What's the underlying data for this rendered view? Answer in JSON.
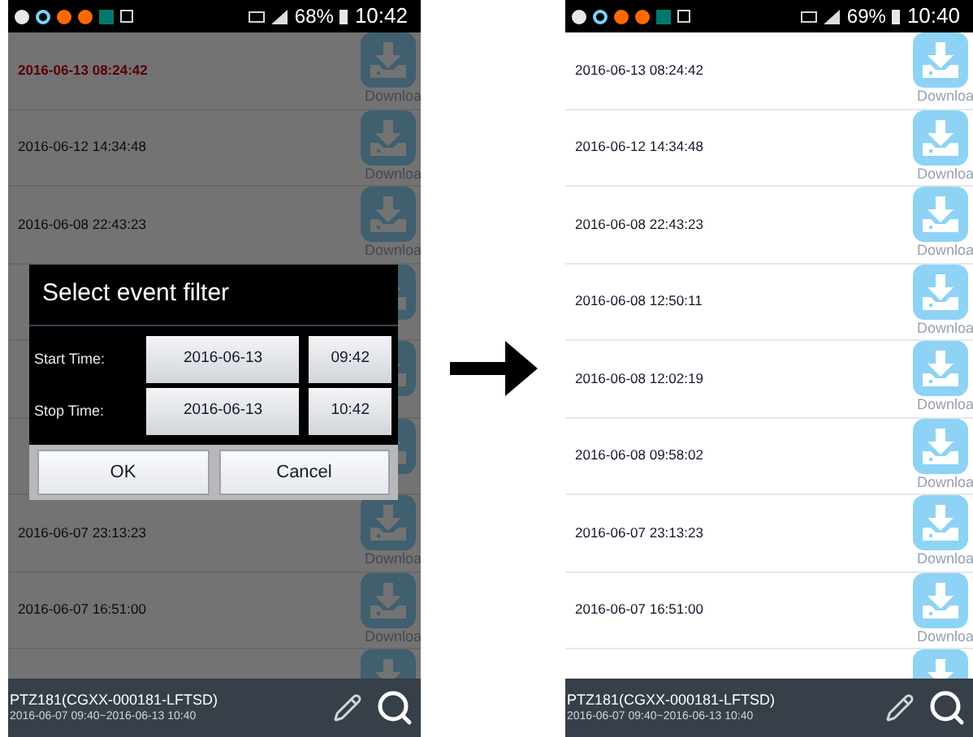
{
  "screens": [
    {
      "status_bar": {
        "battery": "68%",
        "time": "10:42"
      },
      "dimmed": true,
      "events": [
        {
          "time": "2016-06-13 08:24:42",
          "highlighted": true,
          "download": "Downloa"
        },
        {
          "time": "2016-06-12 14:34:48",
          "highlighted": false,
          "download": "Downloa"
        },
        {
          "time": "2016-06-08 22:43:23",
          "highlighted": false,
          "download": "Downloa"
        },
        {
          "kind": "covered"
        },
        {
          "kind": "covered"
        },
        {
          "kind": "covered"
        },
        {
          "time": "2016-06-07 23:13:23",
          "highlighted": false,
          "download": "Downloa"
        },
        {
          "time": "2016-06-07 16:51:00",
          "highlighted": false,
          "download": "Downloa"
        },
        {
          "kind": "covered"
        }
      ],
      "footer": {
        "device": "PTZ181(CGXX-000181-LFTSD)",
        "range": "2016-06-07 09:40~2016-06-13 10:40"
      },
      "dialog": {
        "title": "Select event filter",
        "rows": [
          {
            "label": "Start Time:",
            "date": "2016-06-13",
            "time": "09:42"
          },
          {
            "label": "Stop Time:",
            "date": "2016-06-13",
            "time": "10:42"
          }
        ],
        "buttons": [
          "OK",
          "Cancel"
        ]
      }
    },
    {
      "status_bar": {
        "battery": "69%",
        "time": "10:40"
      },
      "dimmed": false,
      "events": [
        {
          "time": "2016-06-13 08:24:42",
          "highlighted": false,
          "download": "Downloa"
        },
        {
          "time": "2016-06-12 14:34:48",
          "highlighted": false,
          "download": "Downloa"
        },
        {
          "time": "2016-06-08 22:43:23",
          "highlighted": false,
          "download": "Downloa"
        },
        {
          "time": "2016-06-08 12:50:11",
          "highlighted": false,
          "download": "Downloa"
        },
        {
          "time": "2016-06-08 12:02:19",
          "highlighted": false,
          "download": "Downloa"
        },
        {
          "time": "2016-06-08 09:58:02",
          "highlighted": false,
          "download": "Downloa"
        },
        {
          "time": "2016-06-07 23:13:23",
          "highlighted": false,
          "download": "Downloa"
        },
        {
          "time": "2016-06-07 16:51:00",
          "highlighted": false,
          "download": "Downloa"
        },
        {
          "kind": "covered"
        }
      ],
      "footer": {
        "device": "PTZ181(CGXX-000181-LFTSD)",
        "range": "2016-06-07 09:40~2016-06-13 10:40"
      }
    }
  ]
}
